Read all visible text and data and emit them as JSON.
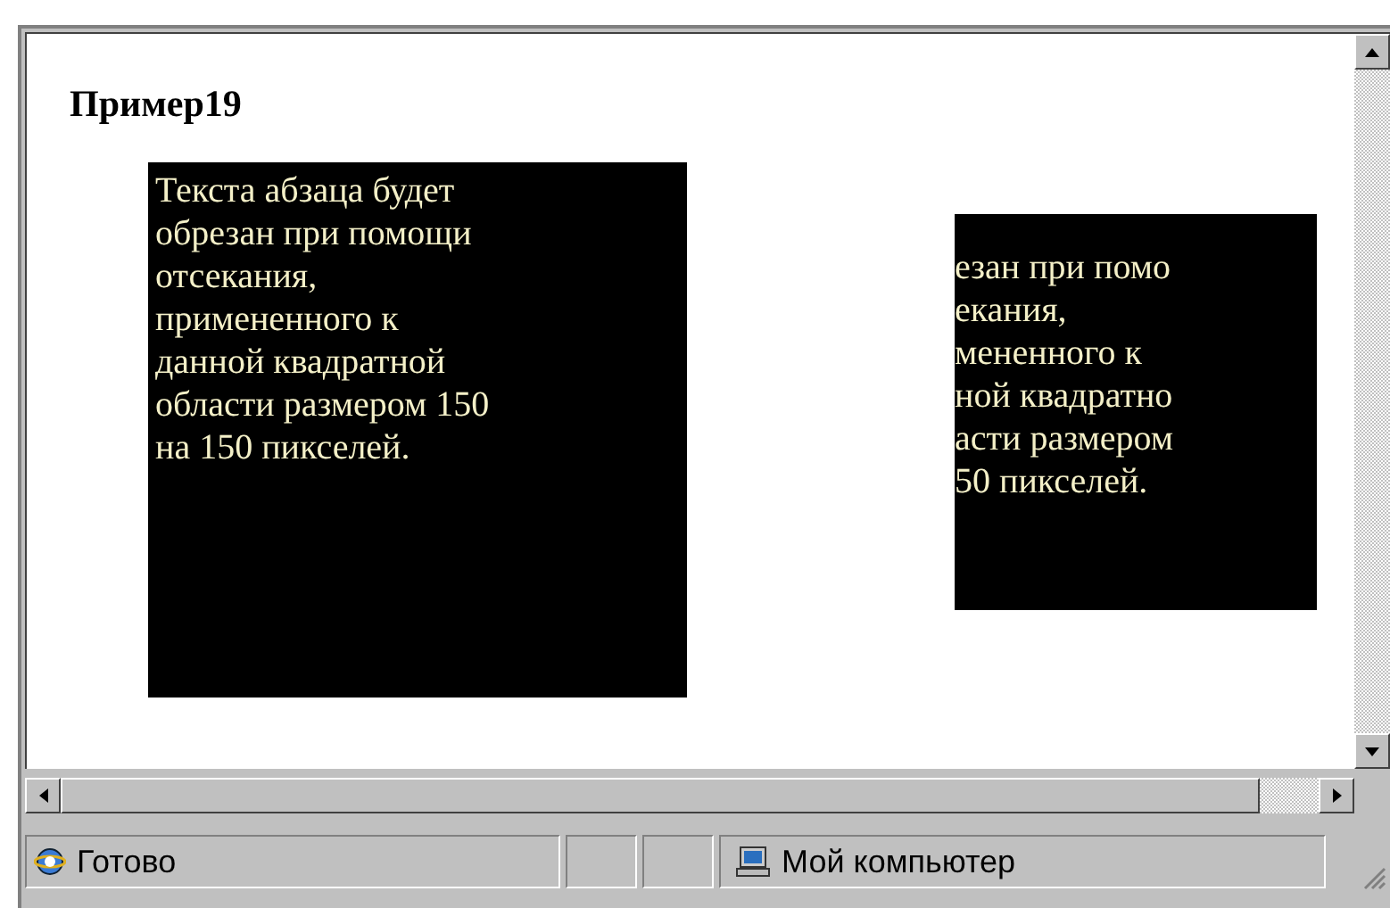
{
  "page": {
    "heading": "Пример19",
    "boxes": [
      {
        "kind": "full",
        "lines": [
          "Текста абзаца будет",
          "обрезан при помощи",
          "отсекания,",
          "примененного к",
          "данной квадратной",
          "области размером 150",
          "на 150 пикселей."
        ]
      },
      {
        "kind": "clipped",
        "lines": [
          "езан при помо",
          "екания,",
          "мененного к",
          "ной квадратно",
          "асти размером",
          "50 пикселей."
        ]
      }
    ]
  },
  "status_bar": {
    "status": "Готово",
    "zone": "Мой компьютер"
  }
}
